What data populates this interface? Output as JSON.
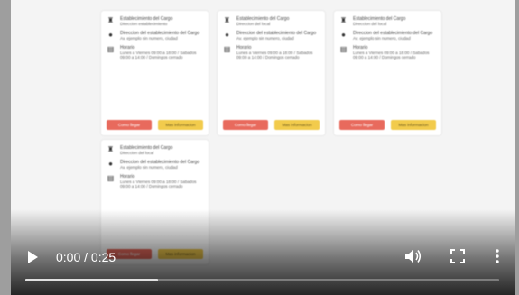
{
  "cards": [
    {
      "store_name": "Establecimiento del Cargo",
      "store_address": "Direccion establecimiento",
      "contact_title": "Direccion del establecimiento del Cargo",
      "contact_body": "Av. ejemplo sin numero, ciudad",
      "hours_title": "Horario",
      "hours_body": "Lunes a Viernes 09:00 a 18:00 / Sabados 09:00 a 14:00 / Domingos cerrado",
      "primary_label": "Como llegar",
      "secondary_label": "Mas informacion"
    },
    {
      "store_name": "Establecimiento del Cargo",
      "store_address": "Direccion del local",
      "contact_title": "Direccion del establecimiento del Cargo",
      "contact_body": "Av. ejemplo sin numero, ciudad",
      "hours_title": "Horario",
      "hours_body": "Lunes a Viernes 09:00 a 18:00 / Sabados 09:00 a 14:00 / Domingos cerrado",
      "primary_label": "Como llegar",
      "secondary_label": "Mas informacion"
    },
    {
      "store_name": "Establecimiento del Cargo",
      "store_address": "Direccion del local",
      "contact_title": "Direccion del establecimiento del Cargo",
      "contact_body": "Av. ejemplo sin numero, ciudad",
      "hours_title": "Horario",
      "hours_body": "Lunes a Viernes 09:00 a 18:00 / Sabados 09:00 a 14:00 / Domingos cerrado",
      "primary_label": "Como llegar",
      "secondary_label": "Mas informacion"
    },
    {
      "store_name": "Establecimiento del Cargo",
      "store_address": "Direccion del local",
      "contact_title": "Direccion del establecimiento del Cargo",
      "contact_body": "Av. ejemplo sin numero, ciudad",
      "hours_title": "Horario",
      "hours_body": "Lunes a Viernes 09:00 a 18:00 / Sabados 09:00 a 14:00 / Domingos cerrado",
      "primary_label": "Como llegar",
      "secondary_label": "Mas informacion"
    }
  ],
  "player": {
    "time_display": "0:00 / 0:25",
    "progress_fraction": 0.28,
    "icons": {
      "play": "play-icon",
      "volume": "volume-icon",
      "fullscreen": "fullscreen-icon",
      "more": "more-options-icon"
    }
  },
  "colors": {
    "primary_button": "#e86a5d",
    "secondary_button": "#f2cb4c"
  }
}
